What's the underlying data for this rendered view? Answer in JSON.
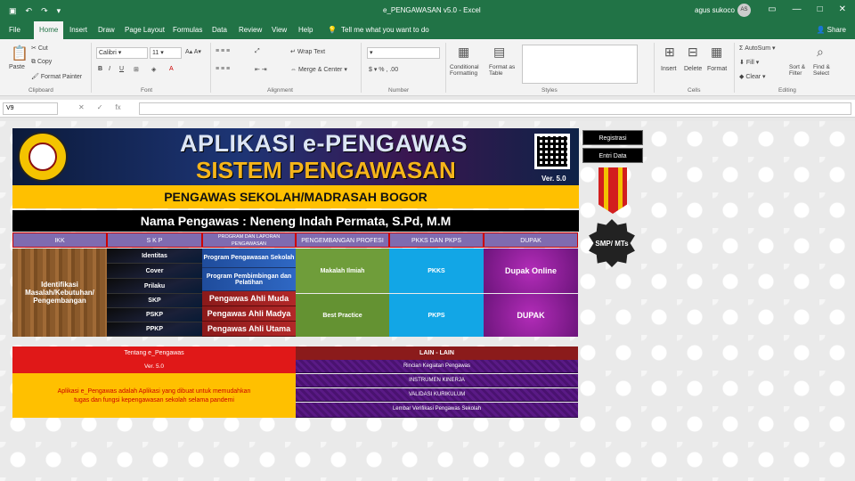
{
  "window": {
    "title": "e_PENGAWASAN v5.0 - Excel",
    "user": "agus sukoco",
    "avatar_initials": "AS"
  },
  "menu": {
    "tabs": [
      "File",
      "Home",
      "Insert",
      "Draw",
      "Page Layout",
      "Formulas",
      "Data",
      "Review",
      "View",
      "Help"
    ],
    "tell_me": "Tell me what you want to do",
    "share": "Share"
  },
  "ribbon": {
    "clipboard": {
      "paste": "Paste",
      "cut": "Cut",
      "copy": "Copy",
      "format_painter": "Format Painter",
      "group": "Clipboard"
    },
    "font": {
      "name": "Calibri",
      "size": "11",
      "group": "Font"
    },
    "alignment": {
      "wrap": "Wrap Text",
      "merge": "Merge & Center",
      "group": "Alignment"
    },
    "number": {
      "group": "Number"
    },
    "styles": {
      "conditional": "Conditional Formatting",
      "format_table": "Format as Table",
      "group": "Styles"
    },
    "cells": {
      "insert": "Insert",
      "delete": "Delete",
      "format": "Format",
      "group": "Cells"
    },
    "editing": {
      "autosum": "AutoSum",
      "fill": "Fill",
      "clear": "Clear",
      "sort": "Sort & Filter",
      "find": "Find & Select",
      "group": "Editing"
    }
  },
  "formula_bar": {
    "cell_ref": "V9",
    "fx": "fx",
    "value": ""
  },
  "banner": {
    "title": "APLIKASI e-PENGAWAS",
    "subtitle": "SISTEM PENGAWASAN",
    "version": "Ver. 5.0",
    "logo_text": "ASOSIASI PENGAWAS SEKOLAH INDONESIA"
  },
  "org_line": "PENGAWAS SEKOLAH/MADRASAH BOGOR",
  "pengawas_line": "Nama Pengawas : Neneng Indah Permata, S.Pd, M.M",
  "nav_headers": [
    "IKK",
    "S K P",
    "PROGRAM DAN LAPORAN PENGAWASAN",
    "PENGEMBANGAN PROFESI",
    "PKKS DAN PKPS",
    "DUPAK"
  ],
  "ikk": {
    "label": "Identifikasi Masalah/Kebutuhan/ Pengembangan"
  },
  "skp_items": [
    "Identitas",
    "Cover",
    "Prilaku",
    "SKP",
    "PSKP",
    "PPKP"
  ],
  "program_items": [
    "Program Pengawasan Sekolah",
    "Program Pembimbingan dan Pelatihan"
  ],
  "ahli_items": [
    "Pengawas Ahli Muda",
    "Pengawas Ahli Madya",
    "Pengawas Ahli Utama"
  ],
  "pengembangan_items": [
    "Makalah Ilmiah",
    "Best Practice"
  ],
  "pkks_items": [
    "PKKS",
    "PKPS"
  ],
  "dupak_items": [
    "Dupak Online",
    "DUPAK"
  ],
  "tentang": {
    "header": "Tentang e_Pengawas",
    "version": "Ver. 5.0",
    "text_line1": "Aplikasi e_Pengawas adalah Aplikasi yang dibuat untuk memudahkan",
    "text_line2": "tugas dan fungsi kepengawasan sekolah selama pandemi"
  },
  "lain": {
    "header": "LAIN - LAIN",
    "items": [
      "Rincian Kegiatan Pengawas",
      "INSTRUMEN KINERJA",
      "VALIDASI KURIKULUM",
      "Lembar Verifikasi Pengawas Sekolah"
    ]
  },
  "side_buttons": [
    "Registrasi",
    "Entri Data"
  ],
  "medal": {
    "label": "SMP/ MTs"
  },
  "colors": {
    "excel_green": "#217346",
    "accent_yellow": "#ffc000",
    "header_purple": "#7f6bb0",
    "red": "#e01818"
  }
}
